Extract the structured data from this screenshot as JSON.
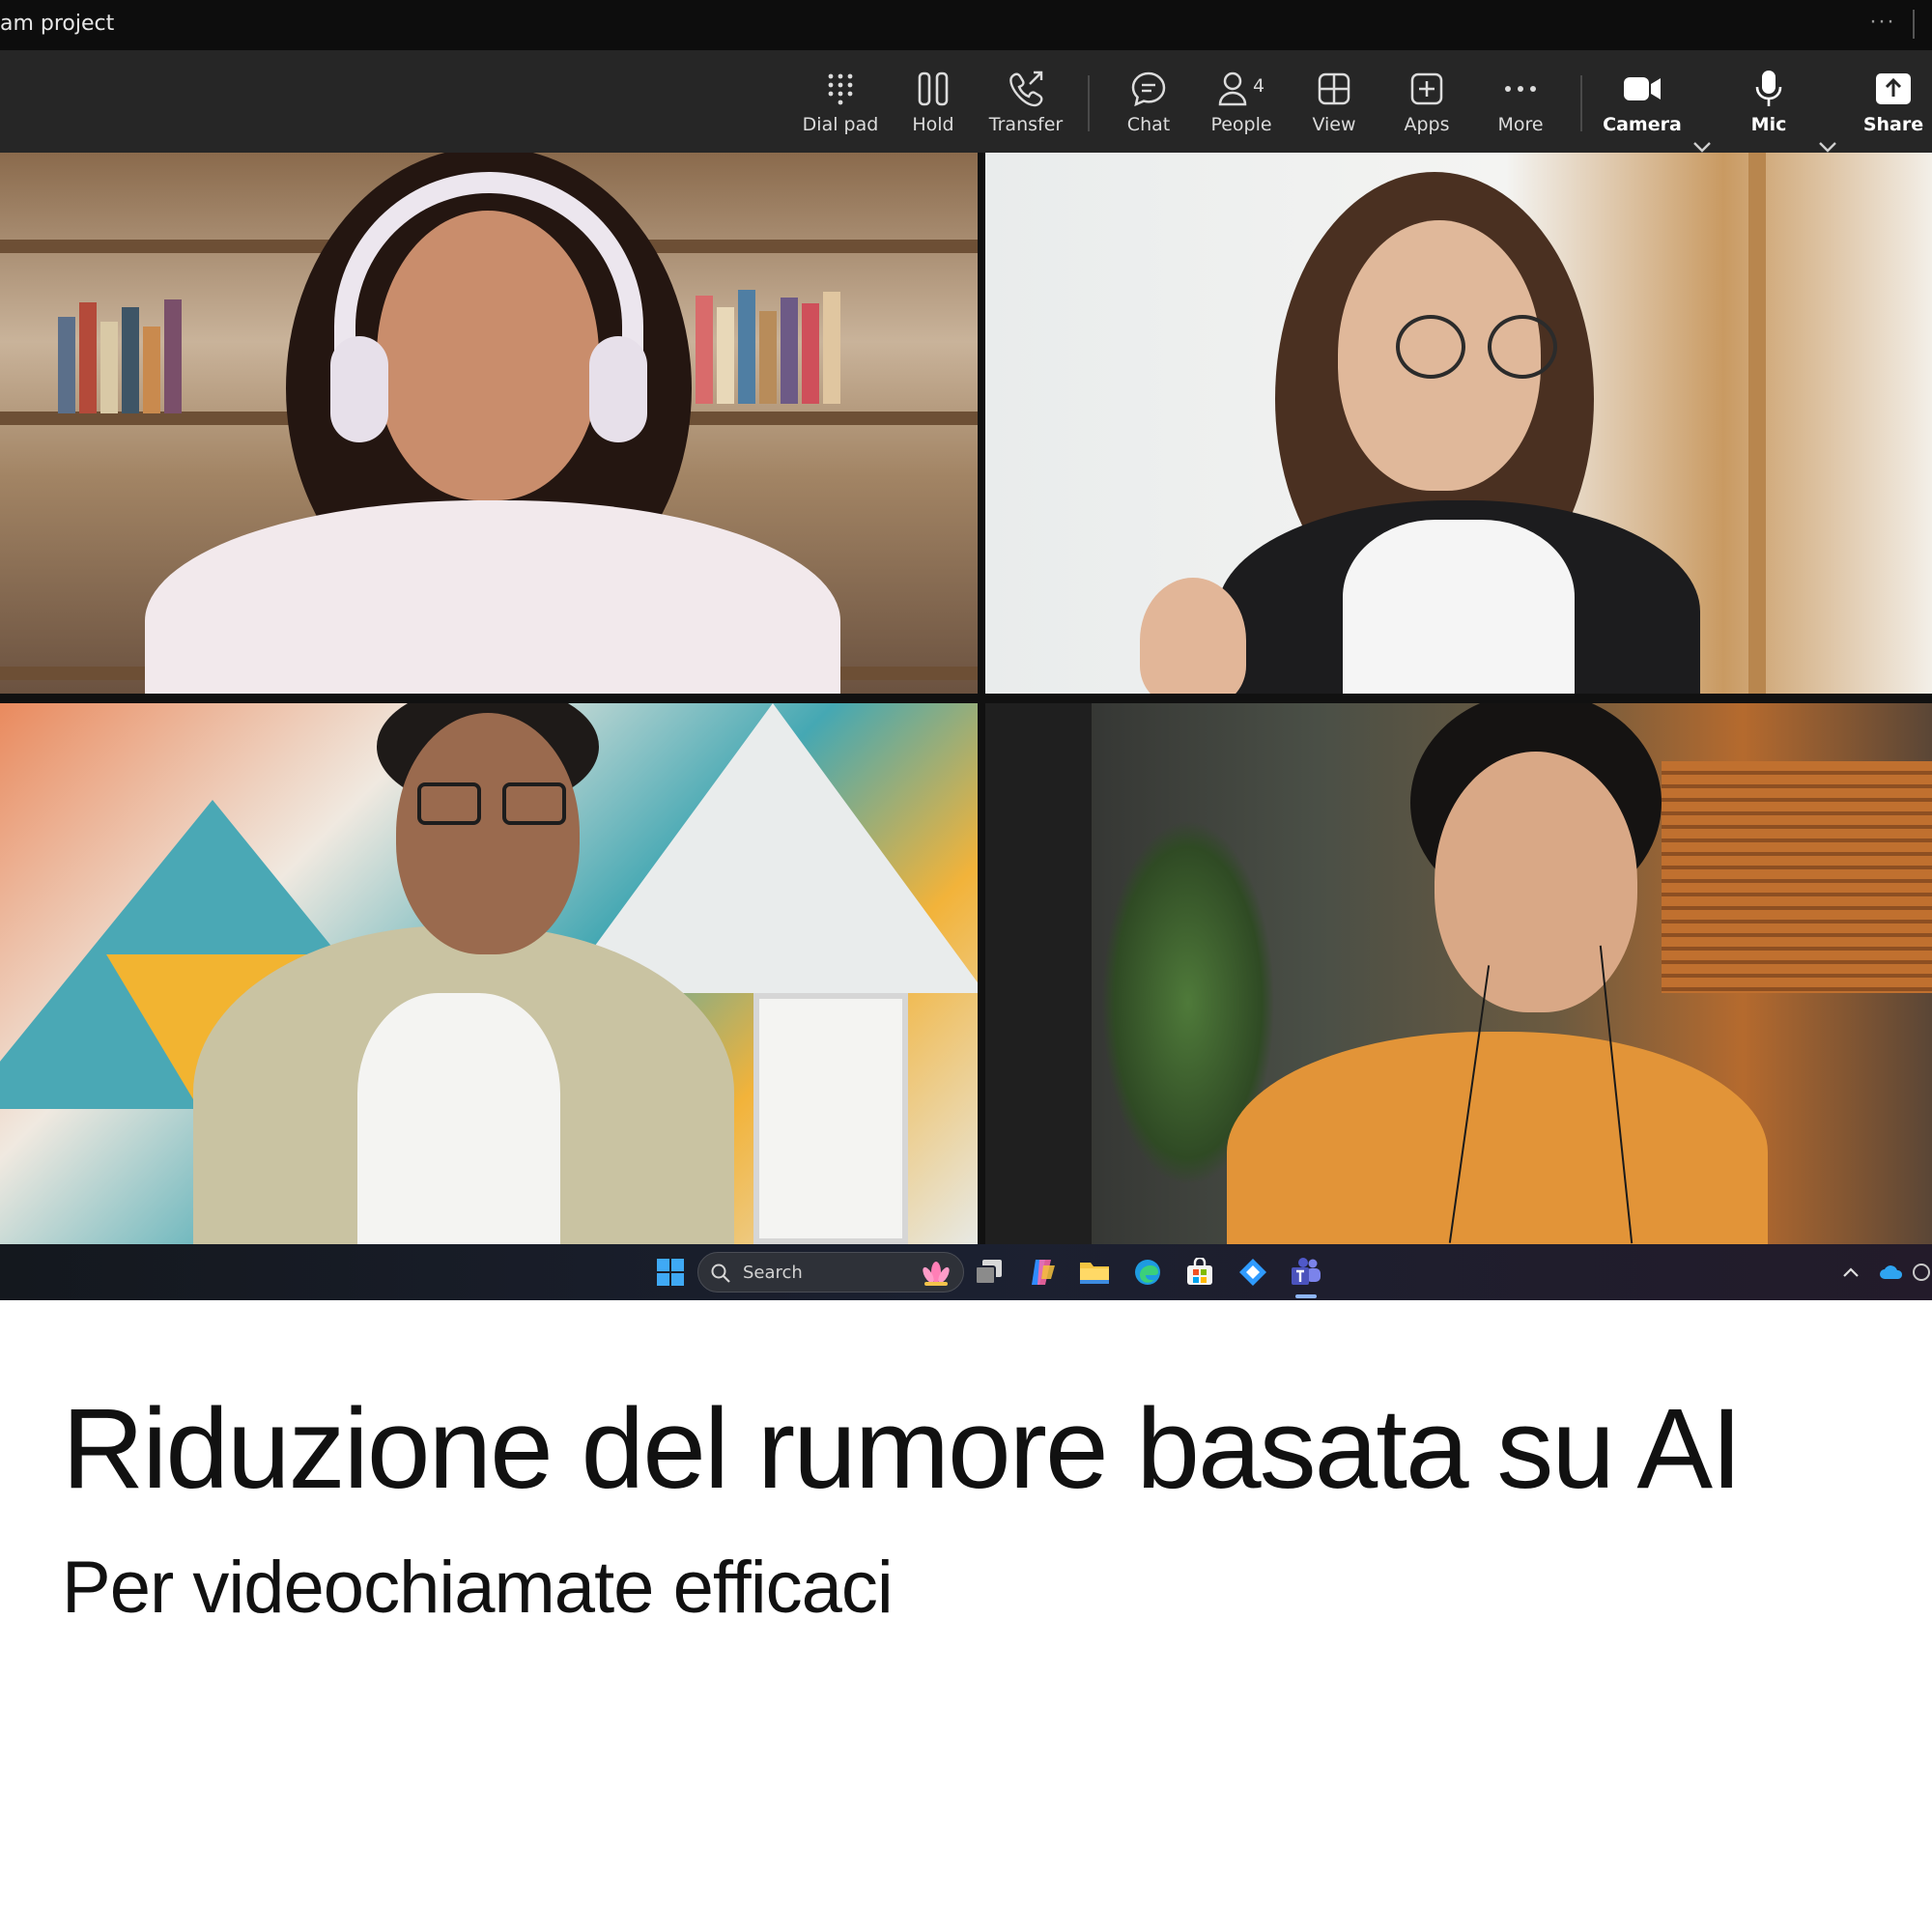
{
  "window": {
    "title": "am project",
    "overflow_dots": "···"
  },
  "toolbar": {
    "dial_pad": "Dial pad",
    "hold": "Hold",
    "transfer": "Transfer",
    "chat": "Chat",
    "people": "People",
    "people_count": "4",
    "view": "View",
    "apps": "Apps",
    "more": "More",
    "camera": "Camera",
    "mic": "Mic",
    "share": "Share"
  },
  "taskbar": {
    "search_placeholder": "Search",
    "icons": [
      "windows-start-icon",
      "search-icon",
      "lotus-icon",
      "task-view-icon",
      "copilot-icon",
      "file-explorer-icon",
      "edge-icon",
      "store-icon",
      "copilot-pin-icon",
      "teams-icon",
      "chevron-up-icon",
      "onedrive-icon"
    ]
  },
  "caption": {
    "headline": "Riduzione del rumore basata su AI",
    "subline": "Per videochiamate efficaci"
  },
  "colors": {
    "titlebar_bg": "#0d0d0d",
    "toolbar_bg": "#262626",
    "caption_text": "#111111",
    "page_bg": "#ffffff"
  }
}
